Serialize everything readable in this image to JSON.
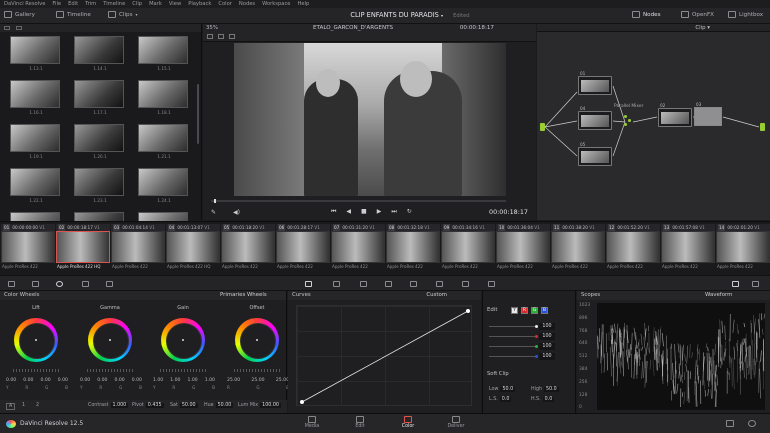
{
  "menubar": {
    "items": [
      "DaVinci Resolve",
      "File",
      "Edit",
      "Trim",
      "Timeline",
      "Clip",
      "Mark",
      "View",
      "Playback",
      "Color",
      "Nodes",
      "Workspace",
      "Help"
    ]
  },
  "toolbar": {
    "gallery": "Gallery",
    "timeline": "Timeline",
    "clips": "Clips",
    "title": "CLIP ENFANTS DU PARADIS",
    "title_status": "Edited",
    "nodes": "Nodes",
    "openfx": "OpenFX",
    "lightbox": "Lightbox"
  },
  "gallery": {
    "stills": [
      "1.13.1",
      "1.14.1",
      "1.15.1",
      "1.16.1",
      "1.17.1",
      "1.18.1",
      "1.19.1",
      "1.20.1",
      "1.21.1",
      "1.22.1",
      "1.23.1",
      "1.24.1",
      "",
      "",
      ""
    ]
  },
  "viewer": {
    "zoom": "35%",
    "clip_name": "ETALO_GARCON_D'ARGENTS",
    "timecode_top": "00:00:18:17",
    "timecode_bottom": "00:00:18:17",
    "progress": 0.01
  },
  "nodes_panel": {
    "dropdown": "Clip",
    "node_labels": [
      "01",
      "04",
      "05",
      "02",
      "03"
    ],
    "mixer_label": "Parallel Mixer"
  },
  "timeline": {
    "clips": [
      {
        "num": "01",
        "tc": "00:00:00:00",
        "track": "V1",
        "codec": "Apple ProRes 422"
      },
      {
        "num": "02",
        "tc": "00:00:18:17",
        "track": "V1",
        "codec": "Apple ProRes 422 HQ",
        "selected": true
      },
      {
        "num": "03",
        "tc": "00:01:04:14",
        "track": "V1",
        "codec": "Apple ProRes 422"
      },
      {
        "num": "04",
        "tc": "00:01:13:07",
        "track": "V1",
        "codec": "Apple ProRes 422 HQ"
      },
      {
        "num": "05",
        "tc": "00:01:18:20",
        "track": "V1",
        "codec": "Apple ProRes 422"
      },
      {
        "num": "06",
        "tc": "00:01:28:17",
        "track": "V1",
        "codec": "Apple ProRes 422"
      },
      {
        "num": "07",
        "tc": "00:01:31:20",
        "track": "V1",
        "codec": "Apple ProRes 422"
      },
      {
        "num": "08",
        "tc": "00:01:32:18",
        "track": "V1",
        "codec": "Apple ProRes 422"
      },
      {
        "num": "09",
        "tc": "00:01:34:16",
        "track": "V1",
        "codec": "Apple ProRes 422"
      },
      {
        "num": "10",
        "tc": "00:01:36:04",
        "track": "V1",
        "codec": "Apple ProRes 422"
      },
      {
        "num": "11",
        "tc": "00:01:38:20",
        "track": "V1",
        "codec": "Apple ProRes 422"
      },
      {
        "num": "12",
        "tc": "00:01:52:20",
        "track": "V1",
        "codec": "Apple ProRes 422"
      },
      {
        "num": "13",
        "tc": "00:01:57:08",
        "track": "V1",
        "codec": "Apple ProRes 422"
      },
      {
        "num": "14",
        "tc": "00:02:01:20",
        "track": "V1",
        "codec": "Apple ProRes 422"
      }
    ]
  },
  "color_wheels": {
    "title": "Color Wheels",
    "mode": "Primaries Wheels",
    "wheels": [
      {
        "name": "Lift",
        "values": [
          "0.00",
          "0.00",
          "0.00",
          "0.00"
        ],
        "channels": [
          "Y",
          "R",
          "G",
          "B"
        ]
      },
      {
        "name": "Gamma",
        "values": [
          "0.00",
          "0.00",
          "0.00",
          "0.00"
        ],
        "channels": [
          "Y",
          "R",
          "G",
          "B"
        ]
      },
      {
        "name": "Gain",
        "values": [
          "1.00",
          "1.00",
          "1.00",
          "1.00"
        ],
        "channels": [
          "Y",
          "R",
          "G",
          "B"
        ]
      },
      {
        "name": "Offset",
        "values": [
          "25.00",
          "25.00",
          "25.00"
        ],
        "channels": [
          "R",
          "G",
          "B"
        ]
      }
    ],
    "page_a": "A",
    "page_1": "1",
    "page_2": "2",
    "contrast_label": "Contrast",
    "contrast_value": "1.000",
    "pivot_label": "Pivot",
    "pivot_value": "0.435",
    "sat_label": "Sat",
    "sat_value": "50.00",
    "hue_label": "Hue",
    "hue_value": "50.00",
    "lummix_label": "Lum Mix",
    "lummix_value": "100.00"
  },
  "curves": {
    "title": "Curves",
    "mode": "Custom",
    "points": [
      [
        0,
        0
      ],
      [
        1,
        1
      ]
    ]
  },
  "edit_panel": {
    "label": "Edit",
    "channels": [
      "Y",
      "R",
      "G",
      "B"
    ],
    "channel_colors": [
      "#e8e8e8",
      "#d92b2b",
      "#2fae3a",
      "#2a52d8"
    ],
    "values": [
      "100",
      "100",
      "100",
      "100"
    ],
    "soft_clip_label": "Soft Clip",
    "low_label": "Low",
    "low_value": "50.0",
    "high_label": "High",
    "high_value": "50.0",
    "ls_label": "L.S.",
    "ls_value": "0.0",
    "hs_label": "H.S.",
    "hs_value": "0.0"
  },
  "scopes": {
    "title": "Scopes",
    "mode": "Waveform",
    "scale": [
      "1023",
      "896",
      "768",
      "640",
      "512",
      "384",
      "256",
      "128",
      "0"
    ]
  },
  "statusbar": {
    "app_name": "DaVinci Resolve 12.5",
    "pages": [
      "Media",
      "Edit",
      "Color",
      "Deliver"
    ],
    "active_page": "Color"
  }
}
